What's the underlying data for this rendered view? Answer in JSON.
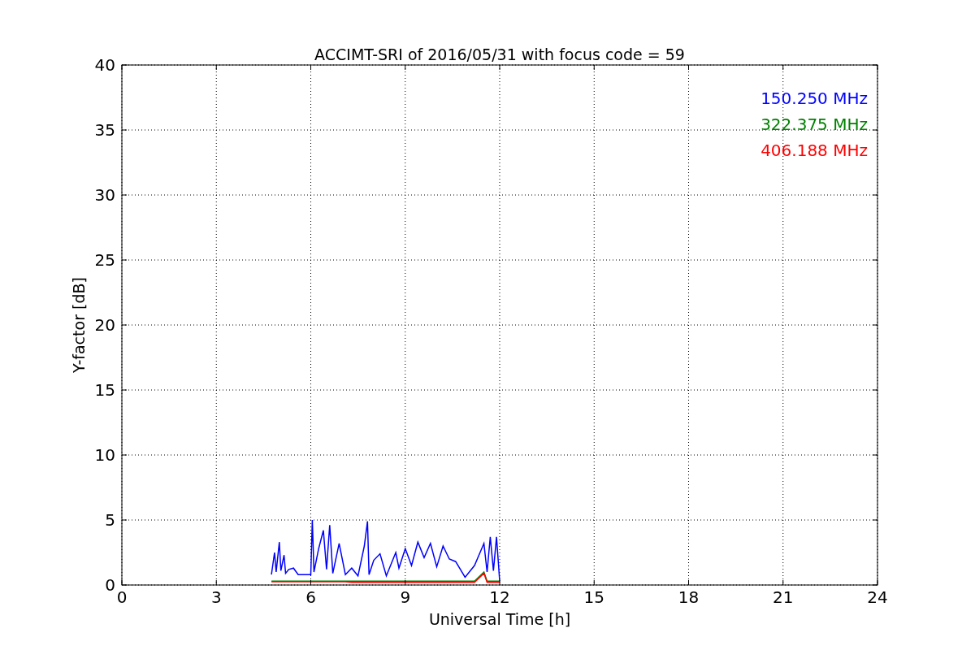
{
  "chart_data": {
    "type": "line",
    "title": "ACCIMT-SRI of 2016/05/31 with focus code = 59",
    "xlabel": "Universal Time [h]",
    "ylabel": "Y-factor [dB]",
    "grid": true,
    "xlim": [
      0,
      24
    ],
    "ylim": [
      0,
      40
    ],
    "xticks": [
      0,
      3,
      6,
      9,
      12,
      15,
      18,
      21,
      24
    ],
    "yticks": [
      0,
      5,
      10,
      15,
      20,
      25,
      30,
      35,
      40
    ],
    "x": [
      4.75,
      4.85,
      4.9,
      5.0,
      5.05,
      5.15,
      5.2,
      5.3,
      5.45,
      5.6,
      6.0,
      6.05,
      6.1,
      6.25,
      6.4,
      6.5,
      6.6,
      6.7,
      6.9,
      7.1,
      7.3,
      7.5,
      7.7,
      7.8,
      7.85,
      8.0,
      8.2,
      8.4,
      8.7,
      8.8,
      9.0,
      9.2,
      9.4,
      9.6,
      9.8,
      10.0,
      10.2,
      10.4,
      10.6,
      10.9,
      11.2,
      11.5,
      11.6,
      11.7,
      11.8,
      11.9,
      12.0
    ],
    "series": [
      {
        "name": "150.250 MHz",
        "color": "#0000ff",
        "values": [
          0.8,
          2.5,
          1.0,
          3.3,
          1.1,
          2.3,
          0.9,
          1.2,
          1.3,
          0.8,
          0.8,
          5.0,
          1.0,
          2.8,
          4.2,
          1.2,
          4.6,
          0.9,
          3.2,
          0.8,
          1.3,
          0.7,
          3.0,
          4.9,
          0.8,
          1.9,
          2.4,
          0.7,
          2.5,
          1.3,
          2.8,
          1.5,
          3.3,
          2.1,
          3.2,
          1.4,
          3.0,
          2.0,
          1.8,
          0.6,
          1.5,
          3.2,
          1.0,
          3.7,
          1.1,
          3.7,
          0.3
        ]
      },
      {
        "name": "322.375 MHz",
        "color": "#008000",
        "values": [
          0.3,
          0.3,
          0.3,
          0.3,
          0.3,
          0.3,
          0.3,
          0.3,
          0.3,
          0.3,
          0.3,
          0.3,
          0.3,
          0.3,
          0.3,
          0.3,
          0.3,
          0.3,
          0.3,
          0.3,
          0.3,
          0.3,
          0.3,
          0.3,
          0.3,
          0.3,
          0.3,
          0.3,
          0.3,
          0.3,
          0.3,
          0.3,
          0.3,
          0.3,
          0.3,
          0.3,
          0.3,
          0.3,
          0.3,
          0.3,
          0.3,
          1.0,
          0.3,
          0.3,
          0.3,
          0.3,
          0.3
        ]
      },
      {
        "name": "406.188 MHz",
        "color": "#ff0000",
        "values": [
          0.25,
          0.25,
          0.25,
          0.25,
          0.25,
          0.25,
          0.25,
          0.25,
          0.25,
          0.25,
          0.25,
          0.25,
          0.25,
          0.25,
          0.25,
          0.25,
          0.25,
          0.25,
          0.25,
          0.25,
          0.2,
          0.2,
          0.2,
          0.2,
          0.2,
          0.2,
          0.2,
          0.2,
          0.2,
          0.2,
          0.2,
          0.2,
          0.2,
          0.2,
          0.2,
          0.2,
          0.2,
          0.2,
          0.2,
          0.2,
          0.2,
          0.9,
          0.2,
          0.2,
          0.2,
          0.2,
          0.2
        ]
      }
    ]
  }
}
